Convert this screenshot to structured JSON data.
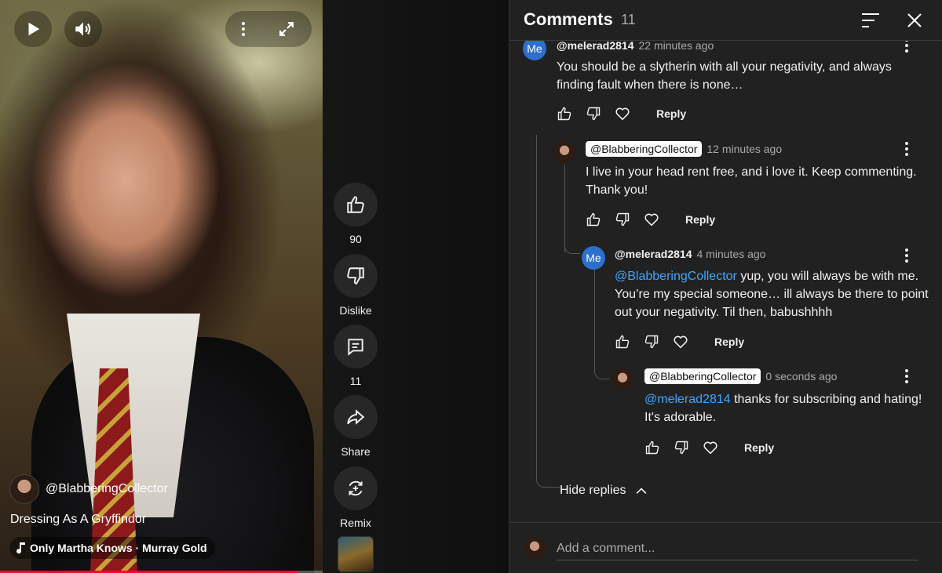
{
  "video": {
    "channel": "@BlabberingCollector",
    "title": "Dressing As A Gryffindor",
    "music": "Only Martha Knows · Murray Gold",
    "progress_pct": 92
  },
  "rail": {
    "like_count": "90",
    "dislike_label": "Dislike",
    "comment_count": "11",
    "share_label": "Share",
    "remix_label": "Remix"
  },
  "panel": {
    "title": "Comments",
    "count": "11",
    "add_placeholder": "Add a comment..."
  },
  "comments": [
    {
      "avatar": "Me",
      "author": "@melerad2814",
      "time": "22 minutes ago",
      "text": "You should be a slytherin with all your negativity, and always finding fault when there is none…",
      "reply_label": "Reply"
    },
    {
      "author": "@BlabberingCollector",
      "time": "12 minutes ago",
      "text": "I live in your head rent free, and i love it. Keep commenting. Thank you!",
      "reply_label": "Reply"
    },
    {
      "avatar": "Me",
      "author": "@melerad2814",
      "time": "4 minutes ago",
      "mention": "@BlabberingCollector",
      "text": " yup, you will always be with me. You’re my special someone… ill always be there to point out your negativity. Til then, babushhhh",
      "reply_label": "Reply"
    },
    {
      "author": "@BlabberingCollector",
      "time": "0 seconds ago",
      "mention": "@melerad2814",
      "text": "  thanks for subscribing and hating! It's adorable.",
      "reply_label": "Reply"
    }
  ],
  "hide_replies_label": "Hide replies"
}
